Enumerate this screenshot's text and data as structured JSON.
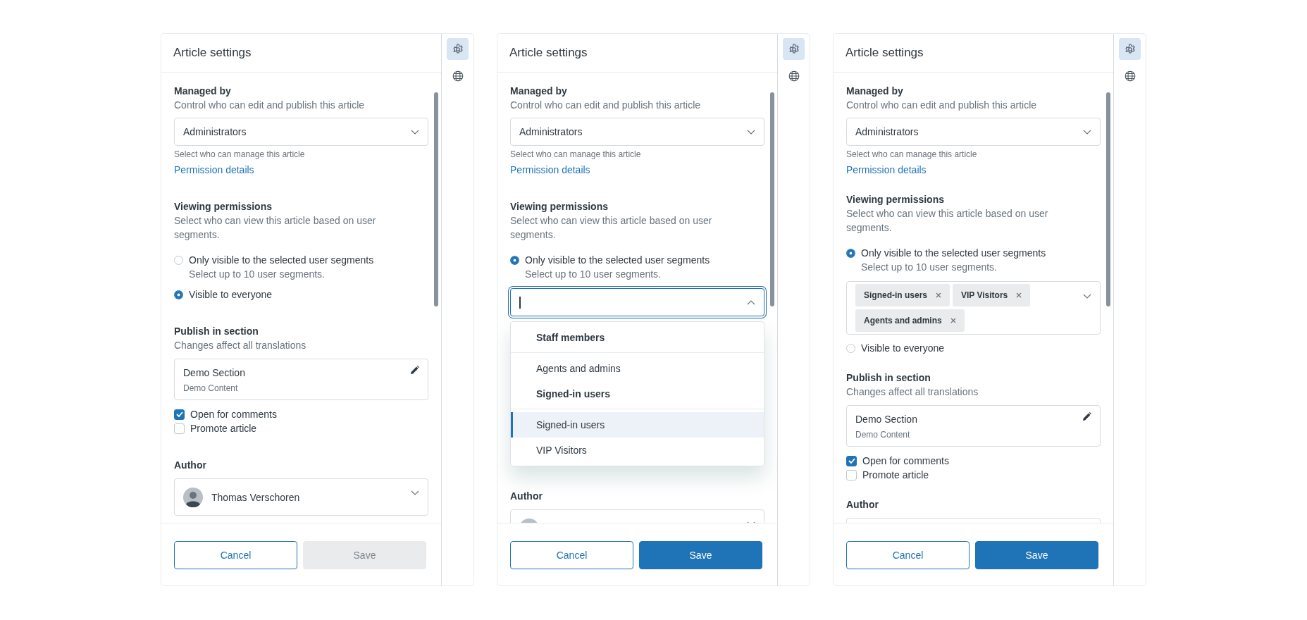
{
  "panels": [
    {
      "title": "Article settings",
      "rail": [
        {
          "kind": "settings",
          "selected": true
        },
        {
          "kind": "globe",
          "selected": false
        }
      ],
      "managed_by": {
        "label": "Managed by",
        "description": "Control who can edit and publish this article",
        "value": "Administrators",
        "hint": "Select who can manage this article",
        "link": "Permission details"
      },
      "viewing": {
        "label": "Viewing permissions",
        "description": "Select who can view this article based on user segments.",
        "options": [
          {
            "label": "Only visible to the selected user segments",
            "hint": "Select up to 10 user segments.",
            "selected": false
          },
          {
            "label": "Visible to everyone",
            "selected": true
          }
        ]
      },
      "publish": {
        "label": "Publish in section",
        "description": "Changes affect all translations",
        "section_name": "Demo Section",
        "section_path": "Demo Content"
      },
      "checkboxes": [
        {
          "label": "Open for comments",
          "checked": true
        },
        {
          "label": "Promote article",
          "checked": false
        }
      ],
      "author": {
        "label": "Author",
        "name": "Thomas Verschoren"
      },
      "buttons": [
        {
          "label": "Cancel",
          "kind": "secondary",
          "disabled": false
        },
        {
          "label": "Save",
          "kind": "primary",
          "disabled": true
        }
      ]
    },
    {
      "title": "Article settings",
      "rail": [
        {
          "kind": "settings",
          "selected": true
        },
        {
          "kind": "globe",
          "selected": false
        }
      ],
      "managed_by": {
        "label": "Managed by",
        "description": "Control who can edit and publish this article",
        "value": "Administrators",
        "hint": "Select who can manage this article",
        "link": "Permission details"
      },
      "viewing": {
        "label": "Viewing permissions",
        "description": "Select who can view this article based on user segments.",
        "options": [
          {
            "label": "Only visible to the selected user segments",
            "hint": "Select up to 10 user segments.",
            "selected": true,
            "field": {
              "expanded": true,
              "menu": [
                {
                  "heading": "Staff members",
                  "items": [
                    {
                      "label": "Agents and admins",
                      "selected": false
                    }
                  ]
                },
                {
                  "heading": "Signed-in users",
                  "items": [
                    {
                      "label": "Signed-in users",
                      "selected": true
                    },
                    {
                      "label": "VIP Visitors",
                      "selected": false
                    }
                  ]
                }
              ]
            }
          }
        ]
      },
      "author": {
        "label": "Author"
      },
      "buttons": [
        {
          "label": "Cancel",
          "kind": "secondary",
          "disabled": false
        },
        {
          "label": "Save",
          "kind": "primary",
          "disabled": false
        }
      ]
    },
    {
      "title": "Article settings",
      "rail": [
        {
          "kind": "settings",
          "selected": true
        },
        {
          "kind": "globe",
          "selected": false
        }
      ],
      "managed_by": {
        "label": "Managed by",
        "description": "Control who can edit and publish this article",
        "value": "Administrators",
        "hint": "Select who can manage this article",
        "link": "Permission details"
      },
      "viewing": {
        "label": "Viewing permissions",
        "description": "Select who can view this article based on user segments.",
        "options": [
          {
            "label": "Only visible to the selected user segments",
            "hint": "Select up to 10 user segments.",
            "selected": true,
            "field": {
              "expanded": false,
              "tags": [
                {
                  "label": "Signed-in users"
                },
                {
                  "label": "VIP Visitors"
                },
                {
                  "label": "Agents and admins"
                }
              ]
            }
          },
          {
            "label": "Visible to everyone",
            "selected": false
          }
        ]
      },
      "publish": {
        "label": "Publish in section",
        "description": "Changes affect all translations",
        "section_name": "Demo Section",
        "section_path": "Demo Content"
      },
      "checkboxes": [
        {
          "label": "Open for comments",
          "checked": true
        },
        {
          "label": "Promote article",
          "checked": false
        }
      ],
      "author": {
        "label": "Author"
      },
      "buttons": [
        {
          "label": "Cancel",
          "kind": "secondary",
          "disabled": false
        },
        {
          "label": "Save",
          "kind": "primary",
          "disabled": false
        }
      ]
    }
  ]
}
